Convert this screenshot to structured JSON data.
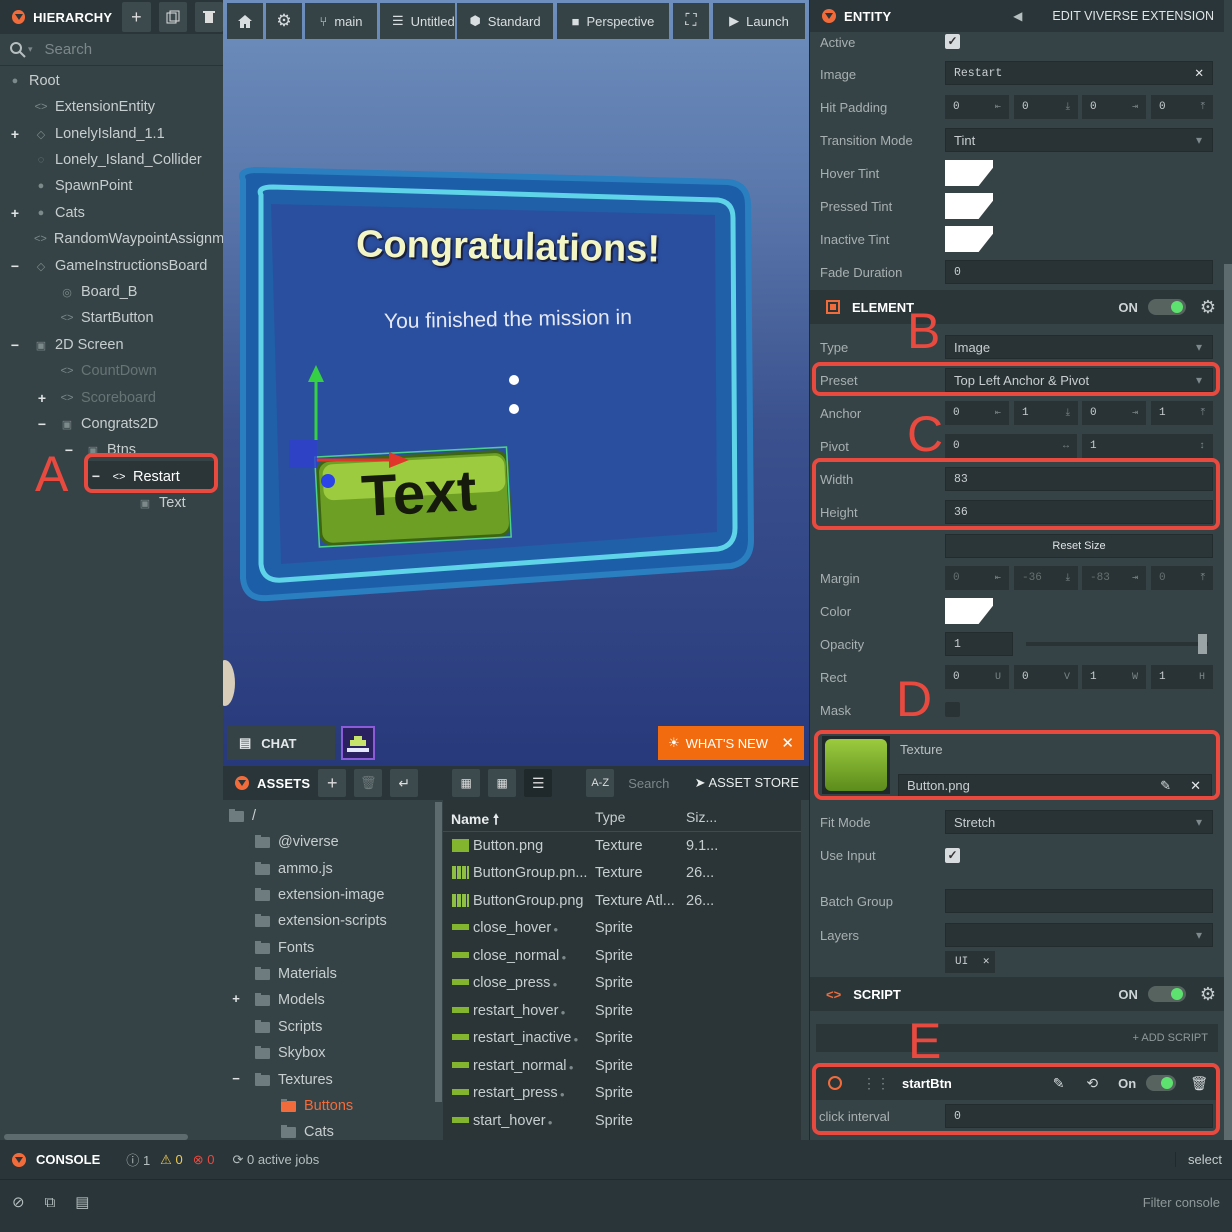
{
  "hierarchy": {
    "title": "HIERARCHY",
    "search_placeholder": "Search",
    "items": [
      {
        "label": "Root"
      },
      {
        "label": "ExtensionEntity"
      },
      {
        "label": "LonelyIsland_1.1"
      },
      {
        "label": "Lonely_Island_Collider"
      },
      {
        "label": "SpawnPoint"
      },
      {
        "label": "Cats"
      },
      {
        "label": "RandomWaypointAssignment"
      },
      {
        "label": "GameInstructionsBoard"
      },
      {
        "label": "Board_B"
      },
      {
        "label": "StartButton"
      },
      {
        "label": "2D Screen"
      },
      {
        "label": "CountDown"
      },
      {
        "label": "Scoreboard"
      },
      {
        "label": "Congrats2D"
      },
      {
        "label": "Btns"
      },
      {
        "label": "Restart"
      },
      {
        "label": "Text"
      }
    ]
  },
  "toolbar": {
    "branch": "main",
    "scene": "Untitled",
    "quality": "Standard",
    "camera": "Perspective",
    "launch": "Launch"
  },
  "scene": {
    "heading": "Congratulations!",
    "subtitle": "You finished the mission in",
    "button_text": "Text"
  },
  "chat": {
    "label": "CHAT"
  },
  "whats_new": {
    "label": "WHAT'S NEW"
  },
  "assets": {
    "title": "ASSETS",
    "search_placeholder": "Search",
    "store": "ASSET STORE",
    "sort": "A-Z",
    "root": "/",
    "folders": [
      {
        "label": "@viverse"
      },
      {
        "label": "ammo.js"
      },
      {
        "label": "extension-image"
      },
      {
        "label": "extension-scripts"
      },
      {
        "label": "Fonts"
      },
      {
        "label": "Materials"
      },
      {
        "label": "Models"
      },
      {
        "label": "Scripts"
      },
      {
        "label": "Skybox"
      },
      {
        "label": "Textures"
      },
      {
        "label": "Buttons"
      },
      {
        "label": "Cats"
      }
    ],
    "columns": {
      "name": "Name",
      "type": "Type",
      "size": "Siz..."
    },
    "files": [
      {
        "name": "Button.png",
        "type": "Texture",
        "size": "9.1..."
      },
      {
        "name": "ButtonGroup.pn...",
        "type": "Texture",
        "size": "26..."
      },
      {
        "name": "ButtonGroup.png",
        "type": "Texture Atl...",
        "size": "26..."
      },
      {
        "name": "close_hover",
        "type": "Sprite",
        "size": ""
      },
      {
        "name": "close_normal",
        "type": "Sprite",
        "size": ""
      },
      {
        "name": "close_press",
        "type": "Sprite",
        "size": ""
      },
      {
        "name": "restart_hover",
        "type": "Sprite",
        "size": ""
      },
      {
        "name": "restart_inactive",
        "type": "Sprite",
        "size": ""
      },
      {
        "name": "restart_normal",
        "type": "Sprite",
        "size": ""
      },
      {
        "name": "restart_press",
        "type": "Sprite",
        "size": ""
      },
      {
        "name": "start_hover",
        "type": "Sprite",
        "size": ""
      }
    ]
  },
  "inspector": {
    "title": "ENTITY",
    "edit_link": "EDIT VIVERSE EXTENSION",
    "button": {
      "active_label": "Active",
      "image_label": "Image",
      "image_value": "Restart",
      "hit_padding_label": "Hit Padding",
      "hit_padding": [
        "0",
        "0",
        "0",
        "0"
      ],
      "transition_label": "Transition Mode",
      "transition_value": "Tint",
      "hover_label": "Hover Tint",
      "pressed_label": "Pressed Tint",
      "inactive_label": "Inactive Tint",
      "fade_label": "Fade Duration",
      "fade_value": "0"
    },
    "element": {
      "title": "ELEMENT",
      "on": "ON",
      "type_label": "Type",
      "type_value": "Image",
      "preset_label": "Preset",
      "preset_value": "Top Left Anchor & Pivot",
      "anchor_label": "Anchor",
      "anchor": [
        "0",
        "1",
        "0",
        "1"
      ],
      "pivot_label": "Pivot",
      "pivot": [
        "0",
        "1"
      ],
      "width_label": "Width",
      "width_value": "83",
      "height_label": "Height",
      "height_value": "36",
      "reset_size": "Reset Size",
      "margin_label": "Margin",
      "margin": [
        "0",
        "-36",
        "-83",
        "0"
      ],
      "color_label": "Color",
      "opacity_label": "Opacity",
      "opacity_value": "1",
      "rect_label": "Rect",
      "rect": [
        "0",
        "0",
        "1",
        "1"
      ],
      "rect_units": [
        "U",
        "V",
        "W",
        "H"
      ],
      "mask_label": "Mask",
      "texture_label": "Texture",
      "texture_value": "Button.png",
      "fit_label": "Fit Mode",
      "fit_value": "Stretch",
      "use_input_label": "Use Input",
      "batch_label": "Batch Group",
      "layers_label": "Layers",
      "layer_tag": "UI"
    },
    "script": {
      "title": "SCRIPT",
      "on": "ON",
      "add": "+ ADD SCRIPT",
      "name": "startBtn",
      "on_small": "On",
      "attr_label": "click interval",
      "attr_value": "0"
    }
  },
  "annotations": {
    "A": "A",
    "B": "B",
    "C": "C",
    "D": "D",
    "E": "E"
  },
  "console": {
    "title": "CONSOLE",
    "info": "1",
    "warn": "0",
    "err": "0",
    "jobs": "0 active jobs",
    "select": "select",
    "filter": "Filter console"
  },
  "colors": {
    "accent": "#f26c3b",
    "annotation": "#e84a40",
    "toggle_on": "#5ee26f",
    "panel": "#364346",
    "header": "#293538"
  }
}
